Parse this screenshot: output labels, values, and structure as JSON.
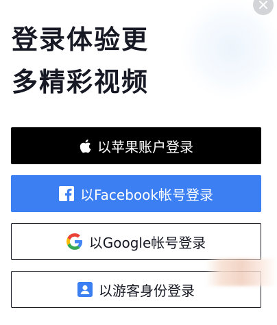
{
  "headline": {
    "line1": "登录体验更",
    "line2": "多精彩视频"
  },
  "login_options": {
    "apple_label": "以苹果账户登录",
    "facebook_label": "以Facebook帐号登录",
    "google_label": "以Google帐号登录",
    "guest_label": "以游客身份登录"
  },
  "icons": {
    "close": "close-icon",
    "apple": "apple-icon",
    "facebook": "facebook-icon",
    "google": "google-icon",
    "guest": "guest-user-icon"
  },
  "colors": {
    "apple_button_bg": "#000000",
    "facebook_button_bg": "#3b7ff2",
    "outline_button_border": "#161823",
    "text": "#161823"
  }
}
